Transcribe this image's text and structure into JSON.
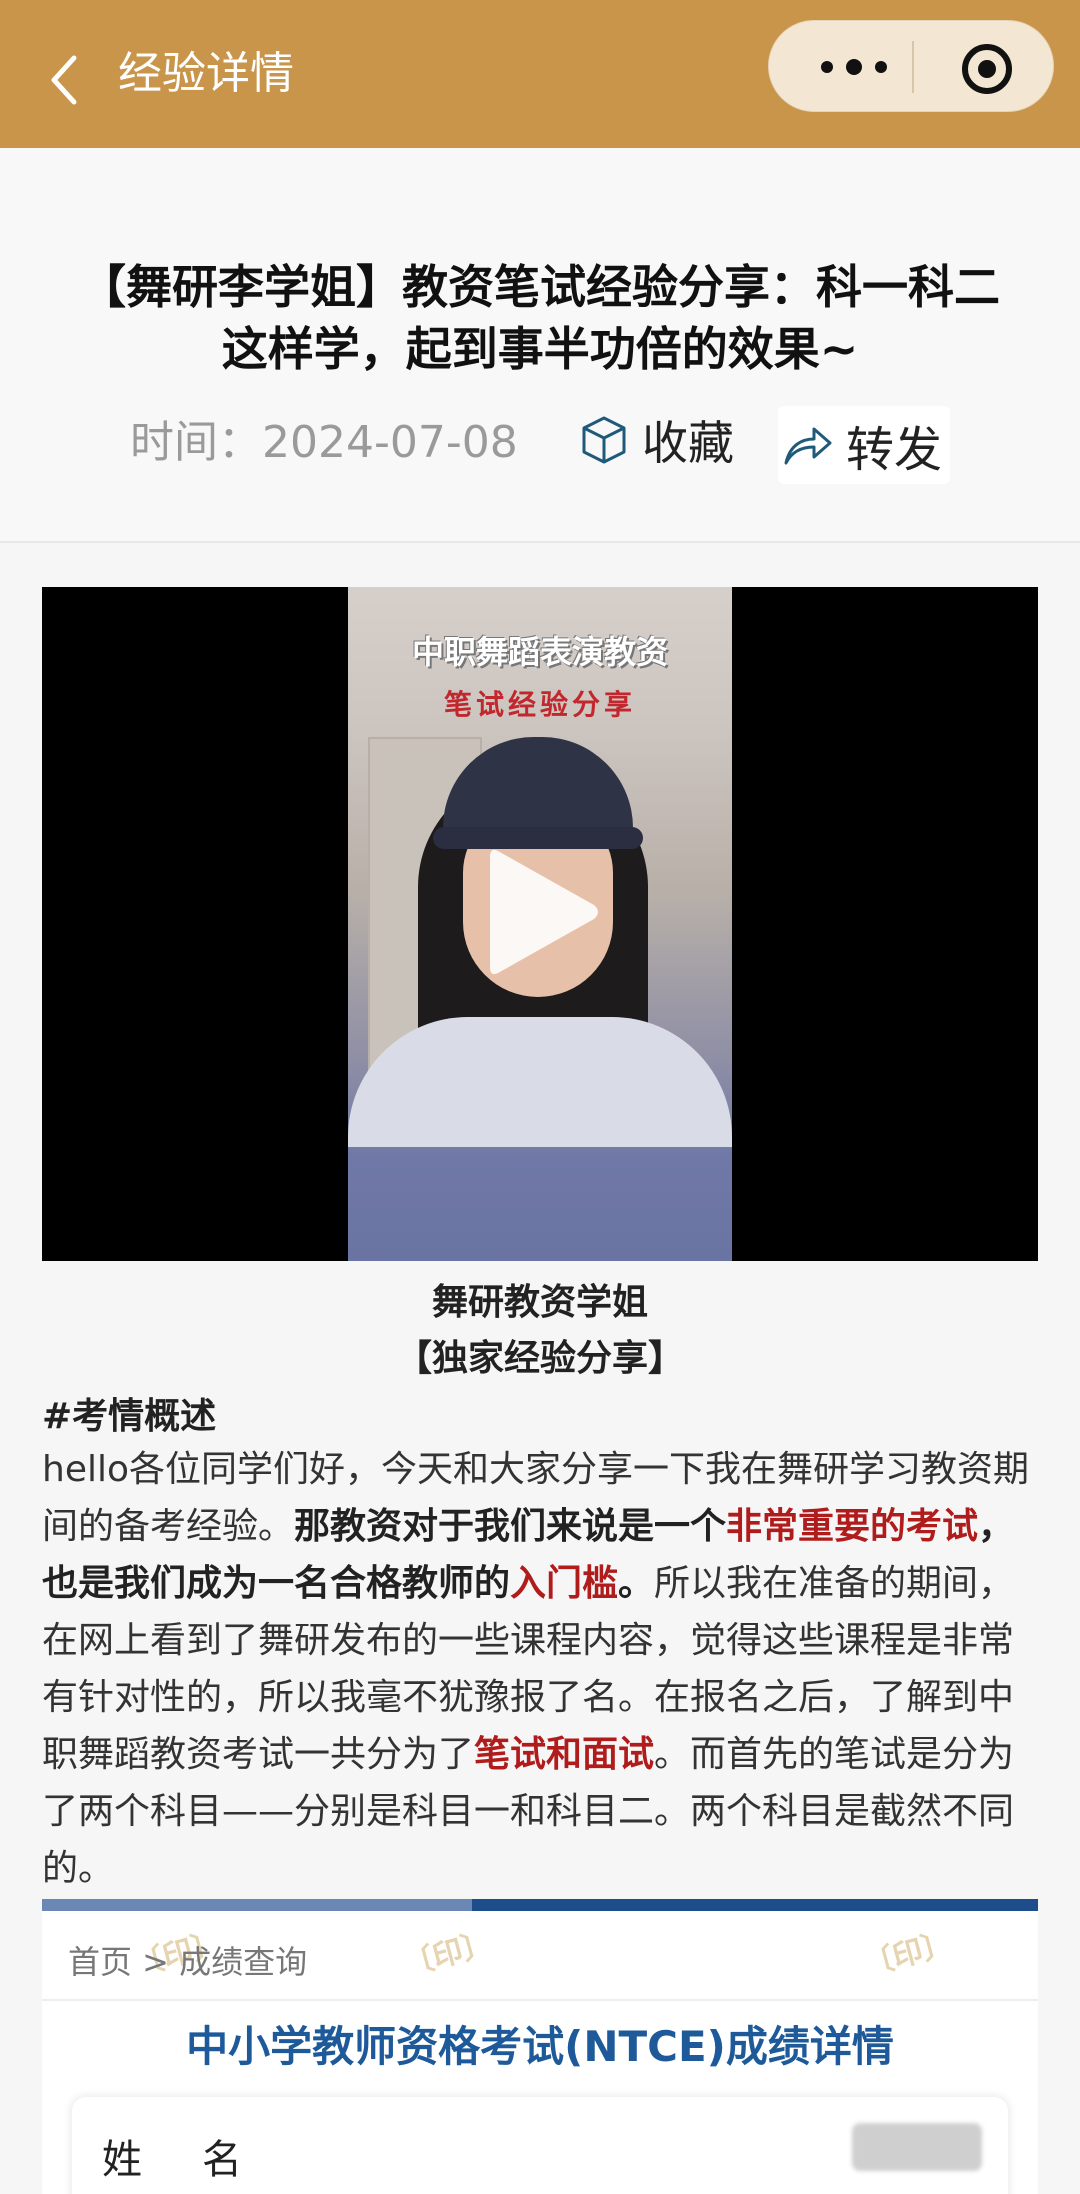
{
  "nav": {
    "title": "经验详情"
  },
  "article": {
    "title": "【舞研李学姐】教资笔试经验分享：科一科二这样学，起到事半功倍的效果~",
    "time": "时间：2024-07-08",
    "favorite_label": "收藏",
    "forward_label": "转发"
  },
  "video": {
    "caption_line1": "中职舞蹈表演教资",
    "caption_line2": "笔试经验分享"
  },
  "body": {
    "caption_name": "舞研教资学姐",
    "caption_tag": "【独家经验分享】",
    "section_heading": "#考情概述",
    "p1_a": "hello各位同学们好，今天和大家分享一下我在舞研学习教资期间的备考经验。",
    "p1_b": "那教资对于我们来说是一个",
    "p1_c": "非常重要的考试",
    "p1_d": "，也是我们成为一名合格教师的",
    "p1_e": "入门槛",
    "p1_f": "。",
    "p1_g": "所以我在准备的期间，在网上看到了舞研发布的一些课程内容，觉得这些课程是非常有针对性的，所以我毫不犹豫报了名。在报名之后，了解到中职舞蹈教资考试一共分为了",
    "p1_h": "笔试和面试",
    "p1_i": "。而首先的笔试是分为了两个科目——分别是科目一和科目二。两个科目是截然不同的。"
  },
  "screenshot": {
    "breadcrumb": "首页 > 成绩查询",
    "title": "中小学教师资格考试(NTCE)成绩详情",
    "row_label": "姓名"
  },
  "colors": {
    "topbar": "#c9954a",
    "highlight_red": "#b01c1c",
    "ntce_blue": "#1e5a9a"
  }
}
